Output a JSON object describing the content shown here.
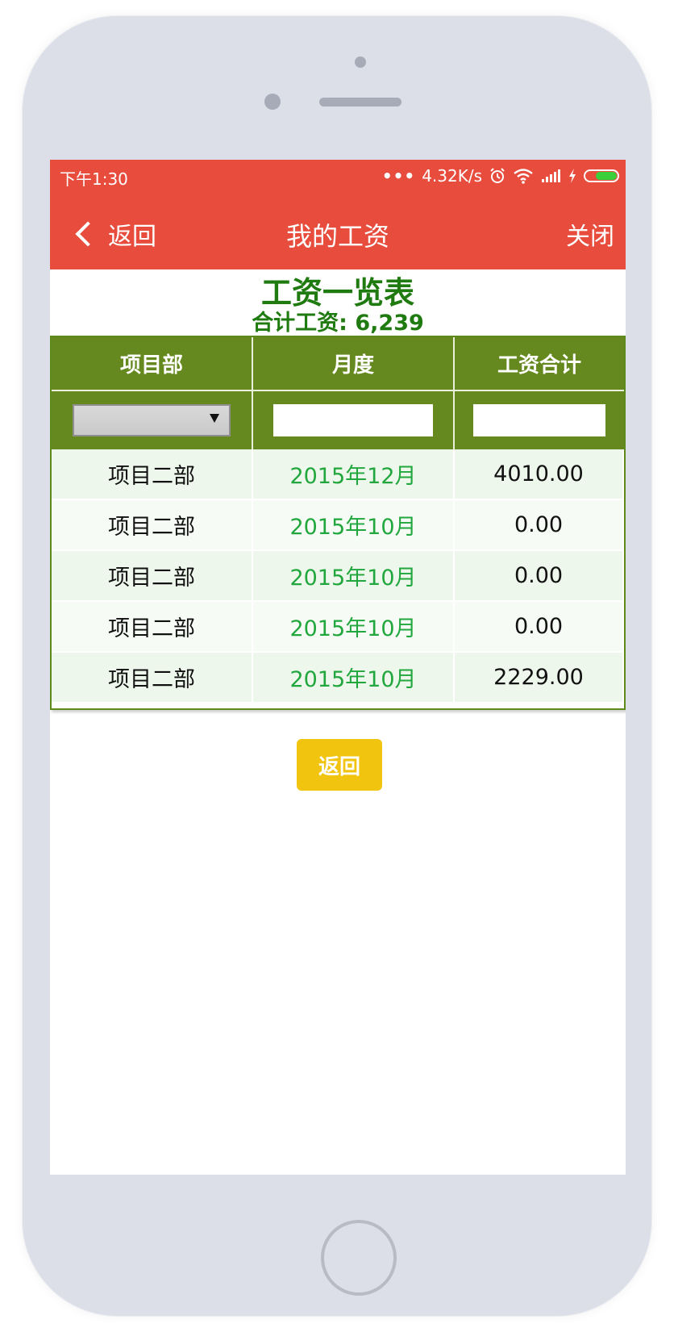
{
  "status_bar": {
    "time": "下午1:30",
    "dots": "•••",
    "network_speed": "4.32K/s",
    "battery_color": "#3ccf3c"
  },
  "nav": {
    "back_label": "返回",
    "title": "我的工资",
    "close_label": "关闭",
    "bar_color": "#e84c3d"
  },
  "summary": {
    "title": "工资一览表",
    "total": "合计工资: 6,239"
  },
  "table": {
    "headers": [
      "项目部",
      "月度",
      "工资合计"
    ],
    "filters": {
      "department_selected": "",
      "month_value": "",
      "amount_value": ""
    },
    "rows": [
      {
        "department": "项目二部",
        "month": "2015年12月",
        "amount": "4010.00"
      },
      {
        "department": "项目二部",
        "month": "2015年10月",
        "amount": "0.00"
      },
      {
        "department": "项目二部",
        "month": "2015年10月",
        "amount": "0.00"
      },
      {
        "department": "项目二部",
        "month": "2015年10月",
        "amount": "0.00"
      },
      {
        "department": "项目二部",
        "month": "2015年10月",
        "amount": "2229.00"
      }
    ],
    "header_color": "#65891e",
    "month_text_color": "#21a73d"
  },
  "footer": {
    "back_button_label": "返回",
    "button_color": "#f1c40f"
  },
  "icons": [
    "chevron-left-icon",
    "dropdown-arrow-icon",
    "alarm-icon",
    "wifi-icon",
    "signal-icon",
    "charging-icon",
    "battery-icon"
  ]
}
